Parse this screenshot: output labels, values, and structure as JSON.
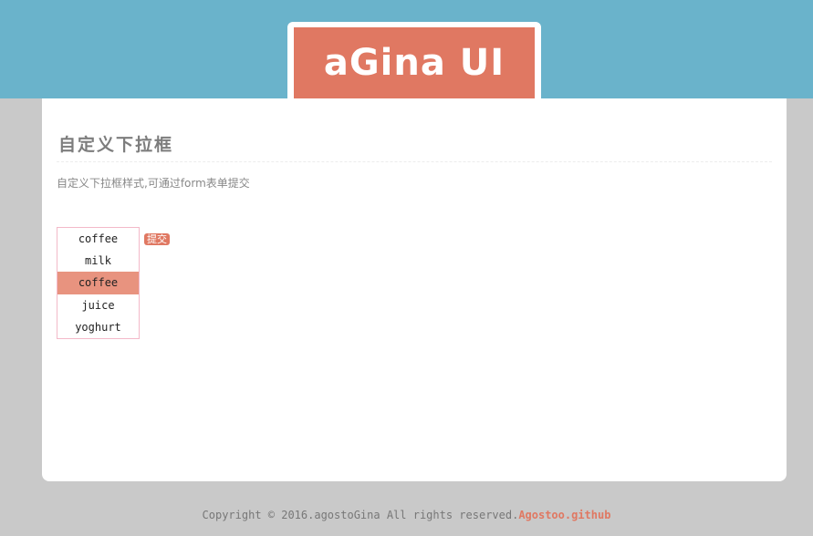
{
  "header": {
    "logo_text": "aGina UI"
  },
  "main": {
    "title": "自定义下拉框",
    "description": "自定义下拉框样式,可通过form表单提交",
    "select": {
      "options": [
        "coffee",
        "milk",
        "coffee",
        "juice",
        "yoghurt"
      ],
      "selected_index": 2
    },
    "submit_label": "提交"
  },
  "footer": {
    "copyright": "Copyright © 2016.agostoGina All rights reserved.",
    "link_text": "Agostoo.github"
  },
  "colors": {
    "accent": "#e07862",
    "header_band": "#6ab3cb",
    "page_background": "#c9c9c9",
    "selected_option": "#e8937f",
    "select_border": "#f3b9c9"
  }
}
